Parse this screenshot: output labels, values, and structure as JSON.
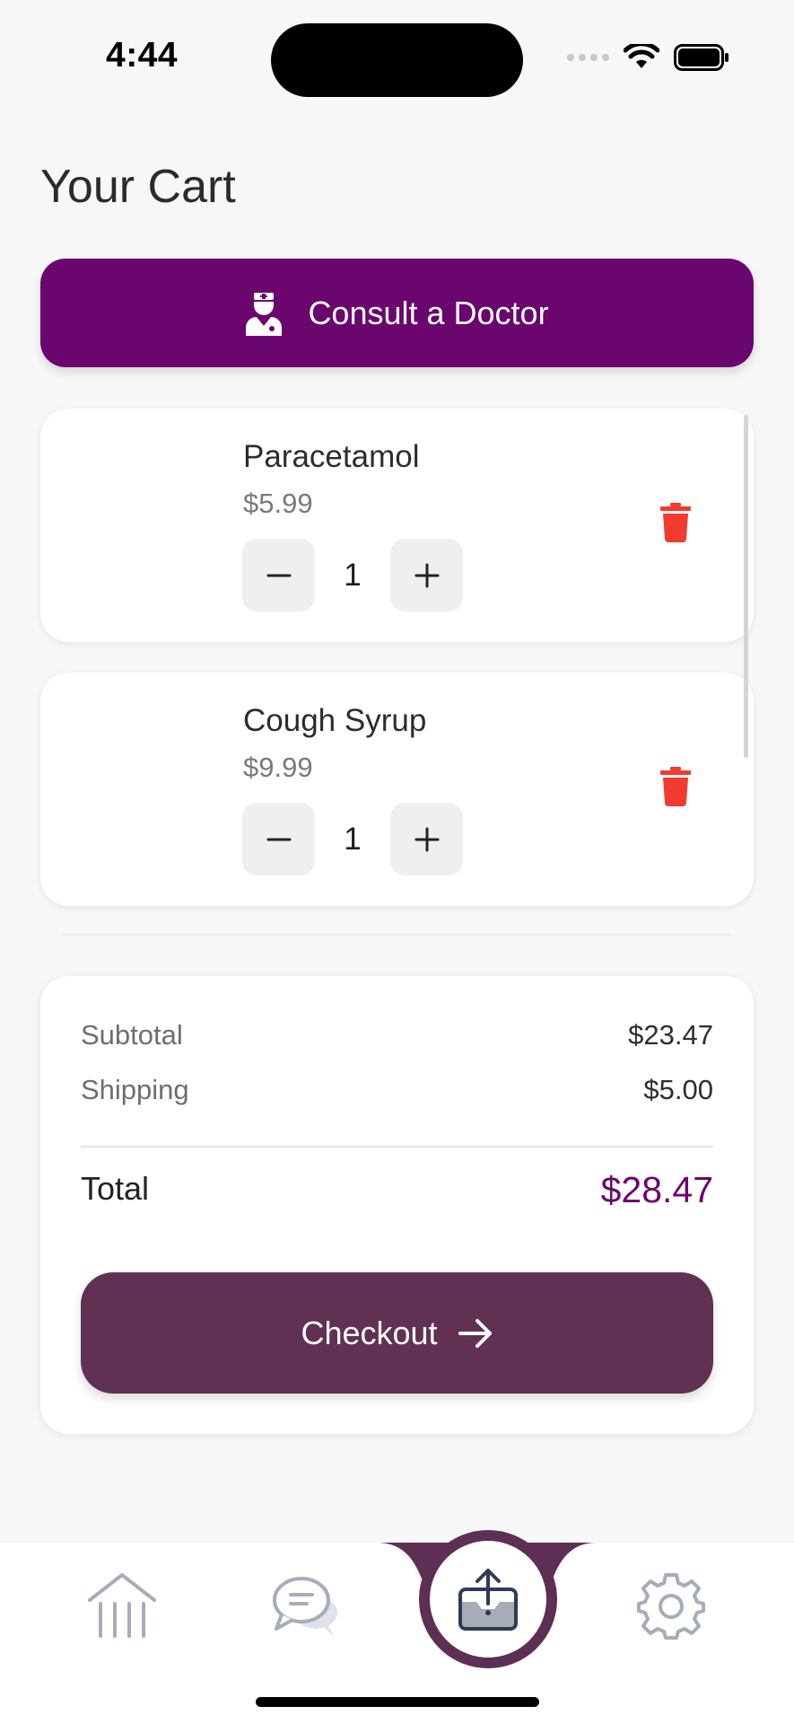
{
  "status_bar": {
    "time": "4:44"
  },
  "page": {
    "title": "Your Cart"
  },
  "consult": {
    "label": "Consult a Doctor",
    "icon": "doctor-icon",
    "color": "#6b066e"
  },
  "cart": {
    "items": [
      {
        "name": "Paracetamol",
        "price": "$5.99",
        "quantity": "1",
        "minus_symbol": "−",
        "plus_symbol": "+"
      },
      {
        "name": "Cough Syrup",
        "price": "$9.99",
        "quantity": "1",
        "minus_symbol": "−",
        "plus_symbol": "+"
      }
    ],
    "delete_color": "#f23b2f"
  },
  "summary": {
    "subtotal_label": "Subtotal",
    "subtotal_value": "$23.47",
    "shipping_label": "Shipping",
    "shipping_value": "$5.00",
    "total_label": "Total",
    "total_value": "$28.47",
    "total_color": "#6b066e",
    "checkout_label": "Checkout",
    "checkout_icon": "arrow-right-icon",
    "checkout_color": "#613153"
  },
  "tab_bar": {
    "tabs": [
      {
        "name": "home",
        "icon": "bank-icon",
        "active": false
      },
      {
        "name": "chat",
        "icon": "chat-bubbles-icon",
        "active": false
      },
      {
        "name": "upload",
        "icon": "upload-tray-icon",
        "active": true
      },
      {
        "name": "settings",
        "icon": "gear-icon",
        "active": false
      }
    ],
    "accent_color": "#5d2f55"
  }
}
